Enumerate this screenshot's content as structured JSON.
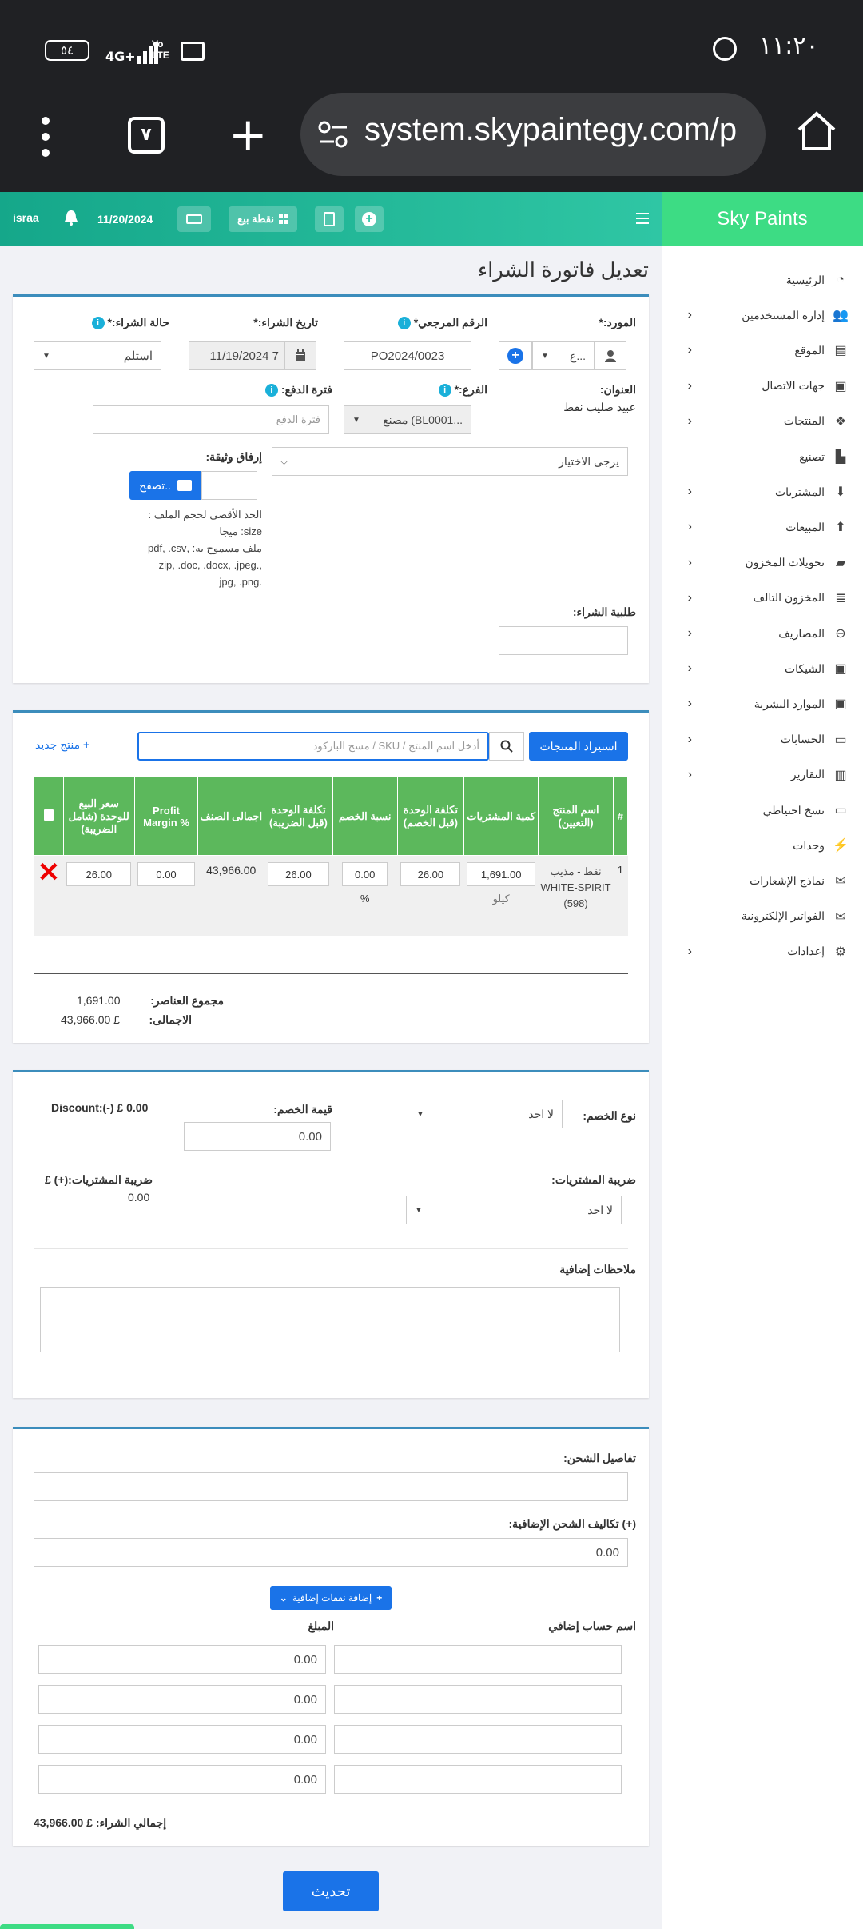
{
  "status_bar": {
    "time": "١١:٢٠",
    "battery": "٥٤",
    "network": "4G+",
    "volte": "Vo LTE"
  },
  "browser": {
    "tab_count": "٧",
    "url": "system.skypaintegy.com/p"
  },
  "topbar": {
    "user": "israa",
    "date": "11/20/2024",
    "pos_label": "نقطة بيع"
  },
  "brand": "Sky Paints",
  "sidebar": {
    "items": [
      {
        "label": "الرئيسية",
        "icon": "dashboard-icon",
        "chevron": false
      },
      {
        "label": "إدارة المستخدمين",
        "icon": "users-icon",
        "chevron": true
      },
      {
        "label": "الموقع",
        "icon": "map-icon",
        "chevron": true
      },
      {
        "label": "جهات الاتصال",
        "icon": "contacts-icon",
        "chevron": true
      },
      {
        "label": "المنتجات",
        "icon": "cubes-icon",
        "chevron": true
      },
      {
        "label": "تصنيع",
        "icon": "industry-icon",
        "chevron": false
      },
      {
        "label": "المشتريات",
        "icon": "arrow-down-circle-icon",
        "chevron": true
      },
      {
        "label": "المبيعات",
        "icon": "arrow-up-circle-icon",
        "chevron": true
      },
      {
        "label": "تحويلات المخزون",
        "icon": "truck-icon",
        "chevron": true
      },
      {
        "label": "المخزون التالف",
        "icon": "database-icon",
        "chevron": true
      },
      {
        "label": "المصاريف",
        "icon": "minus-circle-icon",
        "chevron": true
      },
      {
        "label": "الشيكات",
        "icon": "cheque-icon",
        "chevron": true
      },
      {
        "label": "الموارد البشرية",
        "icon": "hr-icon",
        "chevron": true
      },
      {
        "label": "الحسابات",
        "icon": "money-icon",
        "chevron": true
      },
      {
        "label": "التقارير",
        "icon": "chart-icon",
        "chevron": true
      },
      {
        "label": "نسخ احتياطي",
        "icon": "hdd-icon",
        "chevron": false
      },
      {
        "label": "وحدات",
        "icon": "plug-icon",
        "chevron": false
      },
      {
        "label": "نماذج الإشعارات",
        "icon": "envelope-icon",
        "chevron": false
      },
      {
        "label": "الفواتير الإلكترونية",
        "icon": "envelope-icon",
        "chevron": false
      },
      {
        "label": "إعدادات",
        "icon": "gear-icon",
        "chevron": true
      }
    ]
  },
  "page_title": "تعديل فاتورة الشراء",
  "form": {
    "supplier_label": "المورد:*",
    "supplier_value": "ع...",
    "ref_label": "الرقم المرجعي*",
    "ref_value": "PO2024/0023",
    "date_label": "تاريخ الشراء:*",
    "date_value": "11/19/2024 7",
    "status_label": "حالة الشراء:*",
    "status_value": "استلم",
    "address_label": "العنوان:",
    "address_value": "عبيد صليب نقط",
    "branch_label": "الفرع:*",
    "branch_value": "مصنع (BL0001...",
    "pay_term_label": "فترة الدفع:",
    "pay_term_placeholder": "فترة الدفع",
    "select_placeholder": "يرجى الاختيار",
    "attach_label": "إرفاق وثيقة:",
    "browse_label": "تصفح..",
    "file_help": [
      "الحد الأقصى لحجم الملف :",
      "size: ميجا",
      "ملف مسموح به: ,pdf, .csv",
      ",.zip, .doc, .docx, .jpeg",
      ".jpg, .png"
    ],
    "po_label": "طلبية الشراء:"
  },
  "products": {
    "import_button": "استيراد المنتجات",
    "search_placeholder": "أدخل اسم المنتج / SKU / مسح الباركود",
    "new_product": "منتج جديد",
    "headers": [
      "#",
      "اسم المنتج (التعيين)",
      "كمية المشتريات",
      "تكلفة الوحدة (قبل الخصم)",
      "نسبة الخصم",
      "تكلفة الوحدة (قبل الضريبة)",
      "اجمالى الصنف",
      "Profit Margin %",
      "سعر البيع للوحدة (شامل الضريبة)"
    ],
    "rows": [
      {
        "num": "1",
        "name": "نقط - مذيب WHITE-SPIRIT (598)",
        "qty": "1,691.00",
        "unit": "كيلو",
        "unit_cost": "26.00",
        "discount": "0.00",
        "discount_unit": "%",
        "unit_cost_before_tax": "26.00",
        "line_total": "43,966.00",
        "profit_margin": "0.00",
        "selling_price": "26.00"
      }
    ],
    "total_items_label": "مجموع العناصر:",
    "total_items": "1,691.00",
    "net_total_label": "الاجمالى:",
    "net_total": "43,966.00 £"
  },
  "discount": {
    "type_label": "نوع الخصم:",
    "type_value": "لا احد",
    "amount_label": "قيمة الخصم:",
    "amount_value": "0.00",
    "summary": "Discount:(-) £ 0.00",
    "tax_label": "ضريبة المشتريات:",
    "tax_value": "لا احد",
    "tax_summary_label": "ضريبة المشتريات:(+) £",
    "tax_summary_value": "0.00",
    "notes_label": "ملاحظات إضافية"
  },
  "shipping": {
    "details_label": "تفاصيل الشحن:",
    "charges_label": "(+) تكاليف الشحن الإضافية:",
    "charges_value": "0.00",
    "add_expense_button": "إضافة نفقات إضافية",
    "col_name": "اسم حساب إضافي",
    "col_amount": "المبلغ",
    "expense_amounts": [
      "0.00",
      "0.00",
      "0.00",
      "0.00"
    ],
    "grand_total": "إجمالي الشراء: £ 43,966.00"
  },
  "update_button": "تحديث",
  "colors": {
    "accent": "#1a73e8",
    "header_green": "#5cb85c",
    "brand_green": "#3ddc84",
    "topbar_teal": "#15a78a"
  }
}
